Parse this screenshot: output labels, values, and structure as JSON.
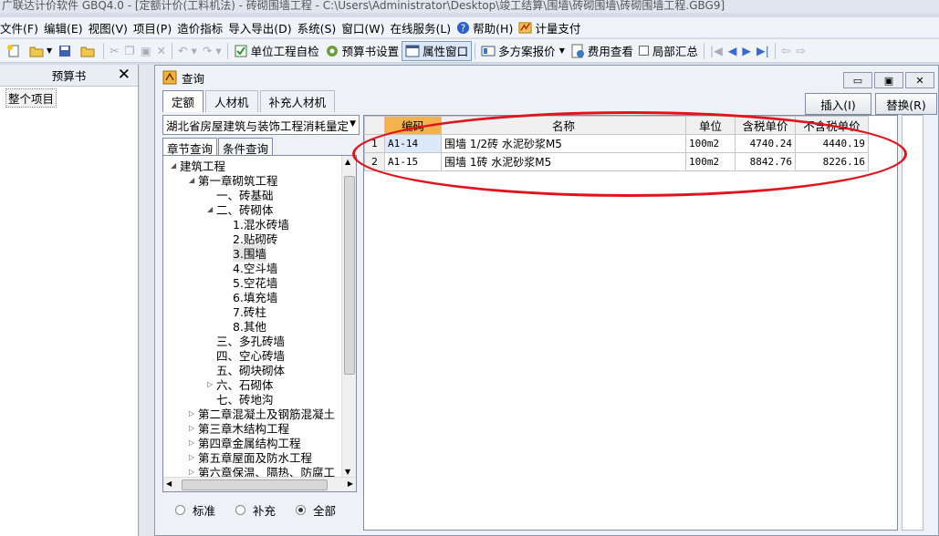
{
  "titlebar": {
    "text": "广联达计价软件 GBQ4.0 - [定额计价(工料机法) - 砖砌围墙工程 - C:\\Users\\Administrator\\Desktop\\竣工结算\\围墙\\砖砌围墙\\砖砌围墙工程.GBG9]"
  },
  "menubar": {
    "items": [
      "文件(F)",
      "编辑(E)",
      "视图(V)",
      "项目(P)",
      "造价指标",
      "导入导出(D)",
      "系统(S)",
      "窗口(W)",
      "在线服务(L)"
    ],
    "help": "帮助(H)",
    "pay": "计量支付"
  },
  "toolbar": {
    "self_check": "单位工程自检",
    "budget_settings": "预算书设置",
    "property_window": "属性窗口",
    "multi_quote": "多方案报价",
    "fee_view": "费用查看",
    "partial_summary": "局部汇总"
  },
  "left_panel": {
    "title": "预算书",
    "item": "整个项目"
  },
  "dialog": {
    "title": "查询",
    "tabs": [
      "定额",
      "人材机",
      "补充人材机"
    ],
    "insert_button": "插入(I)",
    "replace_button": "替换(R)",
    "library": "湖北省房屋建筑与装饰工程消耗量定",
    "subtabs": [
      "章节查询",
      "条件查询"
    ],
    "tree": [
      {
        "label": "建筑工程",
        "toggle": "◢"
      },
      {
        "label": "第一章砌筑工程",
        "toggle": "◢"
      },
      {
        "label": "一、砖基础",
        "toggle": ""
      },
      {
        "label": "二、砖砌体",
        "toggle": "◢"
      },
      {
        "label": "1.混水砖墙",
        "toggle": ""
      },
      {
        "label": "2.贴砌砖",
        "toggle": ""
      },
      {
        "label": "3.围墙",
        "toggle": ""
      },
      {
        "label": "4.空斗墙",
        "toggle": ""
      },
      {
        "label": "5.空花墙",
        "toggle": ""
      },
      {
        "label": "6.填充墙",
        "toggle": ""
      },
      {
        "label": "7.砖柱",
        "toggle": ""
      },
      {
        "label": "8.其他",
        "toggle": ""
      },
      {
        "label": "三、多孔砖墙",
        "toggle": ""
      },
      {
        "label": "四、空心砖墙",
        "toggle": ""
      },
      {
        "label": "五、砌块砌体",
        "toggle": ""
      },
      {
        "label": "六、石砌体",
        "toggle": "▷"
      },
      {
        "label": "七、砖地沟",
        "toggle": ""
      },
      {
        "label": "第二章混凝土及钢筋混凝土",
        "toggle": "▷"
      },
      {
        "label": "第三章木结构工程",
        "toggle": "▷"
      },
      {
        "label": "第四章金属结构工程",
        "toggle": "▷"
      },
      {
        "label": "第五章屋面及防水工程",
        "toggle": "▷"
      },
      {
        "label": "第六章保温、隔热、防腐工",
        "toggle": "▷"
      }
    ],
    "radios": {
      "standard": "标准",
      "supplement": "补充",
      "all": "全部",
      "selected": "all"
    },
    "grid": {
      "headers": {
        "code": "编码",
        "name": "名称",
        "unit": "单位",
        "tax_price": "含税单价",
        "notax_price": "不含税单价"
      },
      "rows": [
        {
          "no": "1",
          "code": "A1-14",
          "name": "围墙 1/2砖 水泥砂浆M5",
          "unit": "100m2",
          "tax_price": "4740.24",
          "notax_price": "4440.19"
        },
        {
          "no": "2",
          "code": "A1-15",
          "name": "围墙 1砖 水泥砂浆M5",
          "unit": "100m2",
          "tax_price": "8842.76",
          "notax_price": "8226.16"
        }
      ]
    }
  },
  "colors": {
    "annotation": "#e0141c",
    "code_header": "#f5b24a"
  }
}
